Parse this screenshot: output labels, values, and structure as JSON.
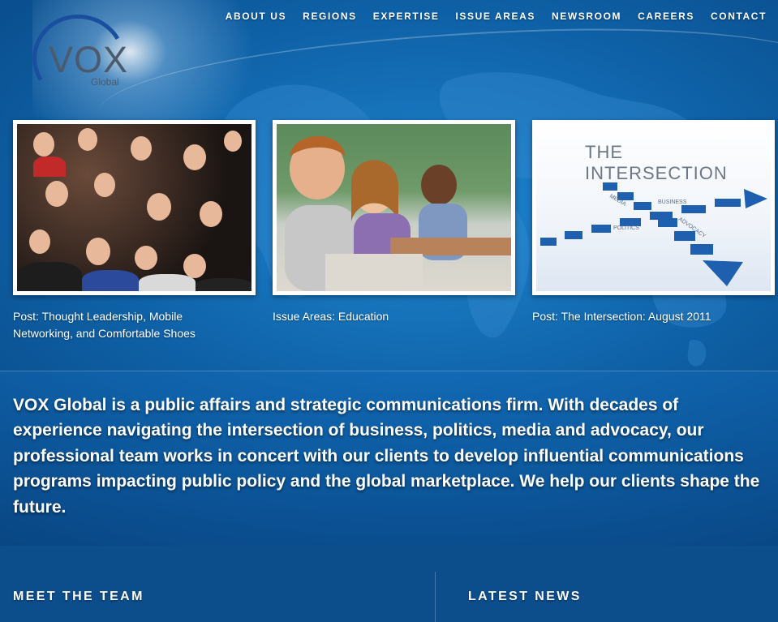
{
  "logo": {
    "name": "VOX",
    "sub": "Global"
  },
  "nav": [
    "ABOUT US",
    "REGIONS",
    "EXPERTISE",
    "ISSUE AREAS",
    "NEWSROOM",
    "CAREERS",
    "CONTACT"
  ],
  "features": [
    {
      "caption": "Post: Thought Leadership, Mobile Networking, and Comfortable Shoes",
      "image": "crowd-cheering-photo"
    },
    {
      "caption": "Issue Areas: Education",
      "image": "children-classroom-photo"
    },
    {
      "caption": "Post: The Intersection: August 2011",
      "image": "intersection-arrows-graphic",
      "image_title": "THE INTERSECTION",
      "arrow_labels": [
        "BUSINESS",
        "MEDIA",
        "POLITICS",
        "ADVOCACY"
      ]
    }
  ],
  "mission": "VOX Global is a public affairs and strategic communications firm. With decades of experience navigating the intersection of business, politics, media and advocacy, our professional team works in concert with our clients to develop influential communications programs impacting public policy and the global marketplace. We help our clients shape the future.",
  "sections": {
    "team": "MEET THE TEAM",
    "news": "LATEST NEWS"
  },
  "colors": {
    "background": "#0f62a8",
    "logo_text": "#4b5a6c",
    "logo_arc": "#1a4fa0",
    "arrow_blue": "#1f5fb0"
  }
}
